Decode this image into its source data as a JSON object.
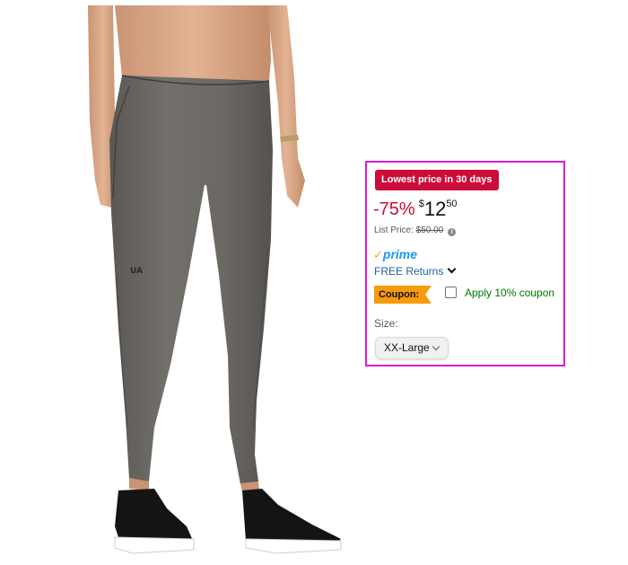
{
  "product": {
    "image_alt": "Women's heather gray leggings with black sneakers"
  },
  "offer": {
    "deal_badge": "Lowest price in 30 days",
    "discount": "-75%",
    "price_symbol": "$",
    "price_whole": "12",
    "price_fraction": "50",
    "list_price_label": "List Price:",
    "list_price_value": "$50.00",
    "prime_check": "✓",
    "prime_text": "prime",
    "returns_link": "FREE Returns",
    "coupon_tag": "Coupon:",
    "coupon_label": "Apply 10% coupon",
    "coupon_checked": false,
    "size_label": "Size:",
    "size_selected": "XX-Large"
  },
  "colors": {
    "deal_badge_bg": "#cc0c39",
    "discount_text": "#cc0c39",
    "prime_blue": "#1a98ff",
    "prime_check": "#f7a31c",
    "link_blue": "#2162a1",
    "coupon_tag_bg": "#f79b0b",
    "coupon_text": "#007600",
    "highlight_border": "#d61ed6",
    "leggings": "#6b6863"
  }
}
